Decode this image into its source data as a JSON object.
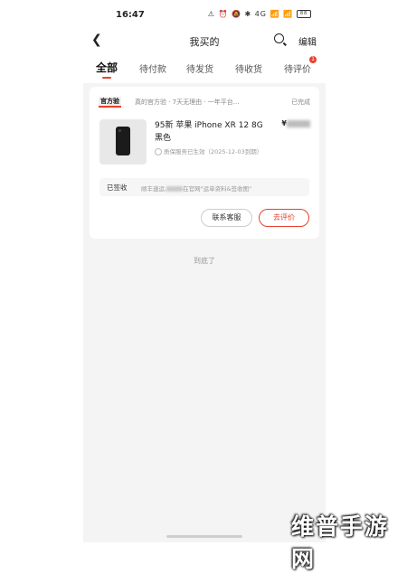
{
  "status_bar": {
    "time": "16:47",
    "icons_text": "⚠ ⏰ 🔕 ✱ 4G 📶 📶",
    "battery": "88"
  },
  "nav": {
    "back_icon": "chevron-left-icon",
    "title": "我买的",
    "search_icon": "search-icon",
    "edit_label": "编辑"
  },
  "tabs": [
    {
      "label": "全部",
      "active": true
    },
    {
      "label": "待付款"
    },
    {
      "label": "待发货"
    },
    {
      "label": "待收货"
    },
    {
      "label": "待评价"
    }
  ],
  "tab_badge": "1",
  "order": {
    "shop_logo": "官方验",
    "shop_slogan": "真的官方验 · 7天无理由 · 一年平台...",
    "status": "已完成",
    "product_name": "95新 苹果 iPhone XR 12 8G 黑色",
    "price_symbol": "¥",
    "service": "质保服务已生效（2025-12-03到期）",
    "logistics_status": "已签收",
    "logistics_prefix": "顺丰速运,",
    "logistics_suffix": "在官网\"运单资料&签收图\"",
    "buttons": {
      "contact": "联系客服",
      "review": "去评价"
    }
  },
  "end_text": "到底了",
  "watermark": "维普手游网",
  "colors": {
    "accent": "#e8412c",
    "background": "#f4f4f4"
  }
}
